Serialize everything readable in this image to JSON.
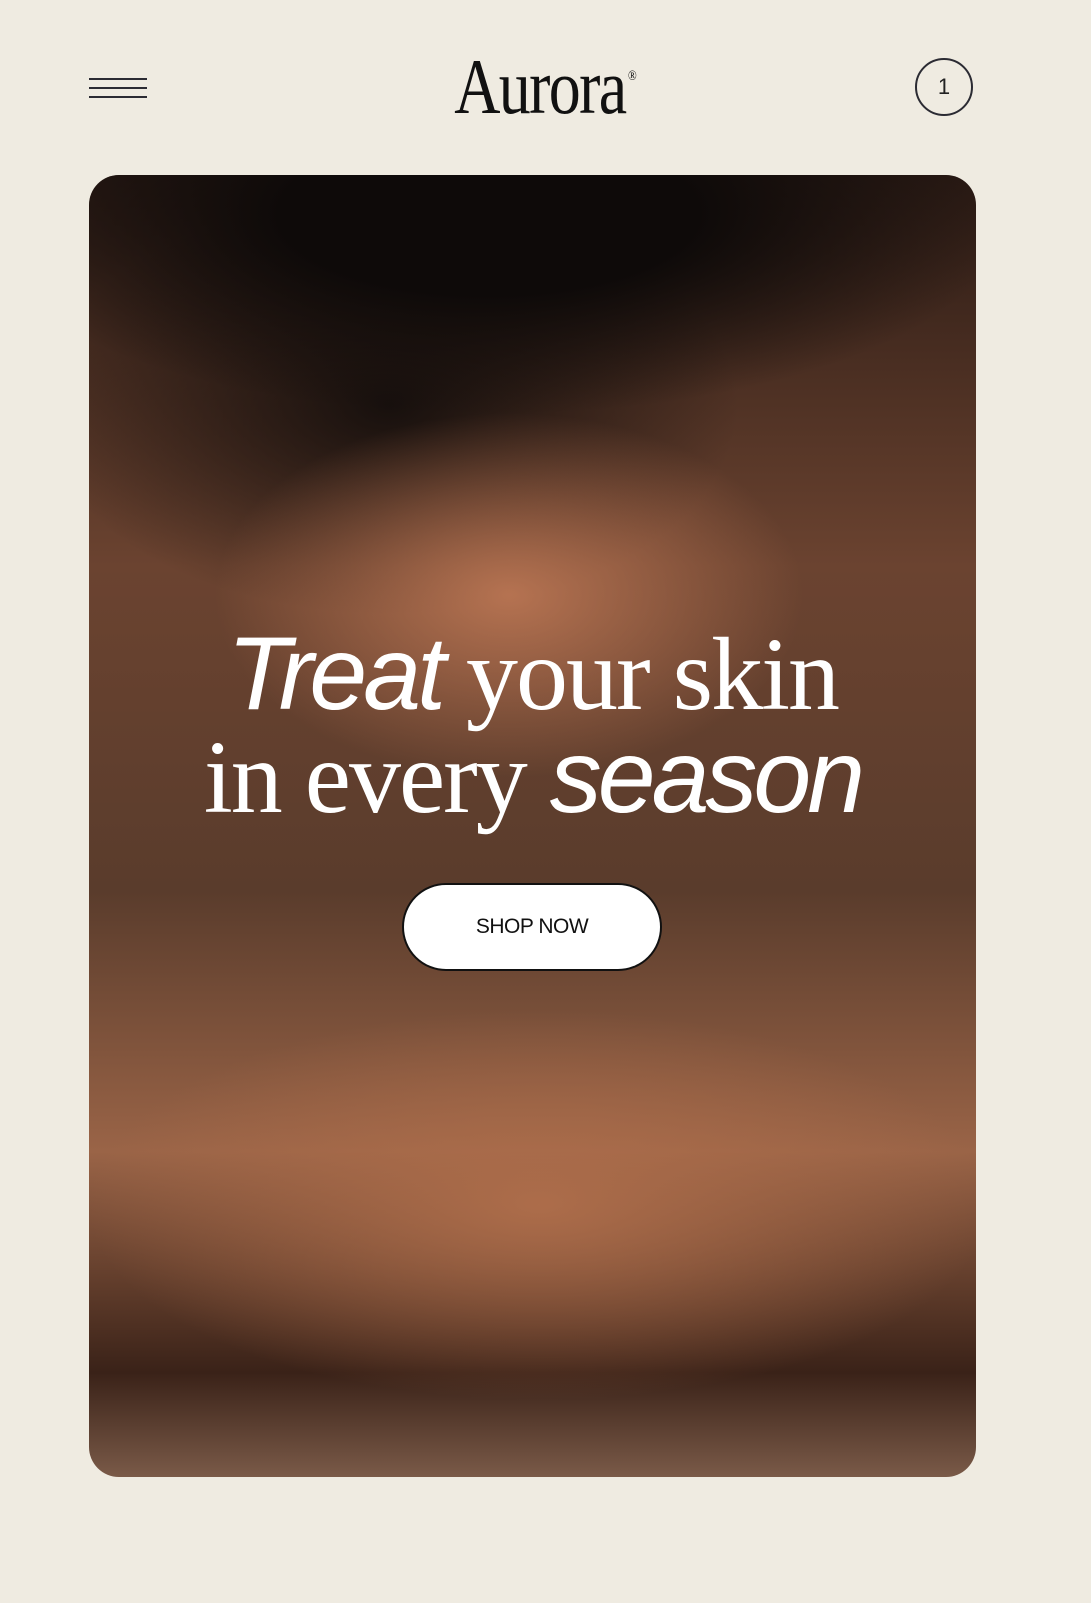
{
  "header": {
    "menu_icon": "hamburger-menu-icon",
    "logo": "Aurora",
    "logo_mark": "®",
    "cart_count": "1"
  },
  "hero": {
    "headline_line1_italic": "Treat",
    "headline_line1_rest": " your skin",
    "headline_line2_start": "in every ",
    "headline_line2_italic": "season",
    "cta_label": "SHOP NOW"
  },
  "colors": {
    "background": "#efebe1",
    "text": "#111111",
    "button_bg": "#ffffff"
  }
}
